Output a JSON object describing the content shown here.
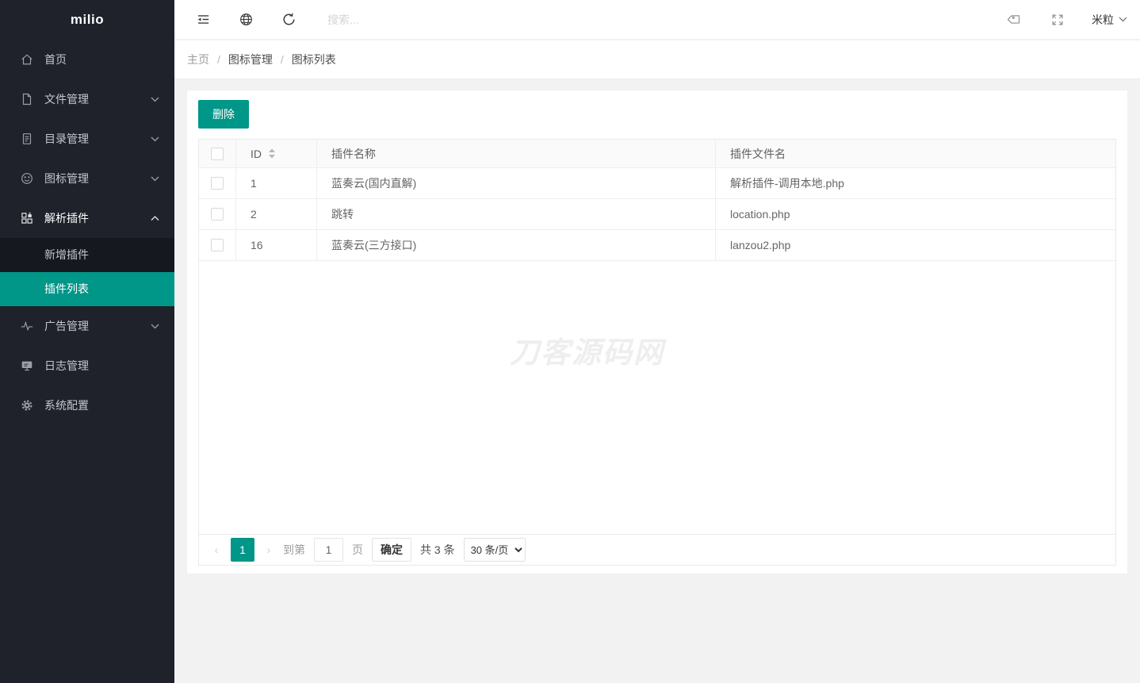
{
  "app": {
    "logo": "milio"
  },
  "sidebar": {
    "items": [
      {
        "label": "首页",
        "icon": "home-icon"
      },
      {
        "label": "文件管理",
        "icon": "file-icon",
        "chevron": "down"
      },
      {
        "label": "目录管理",
        "icon": "document-icon",
        "chevron": "down"
      },
      {
        "label": "图标管理",
        "icon": "smiley-icon",
        "chevron": "down"
      },
      {
        "label": "解析插件",
        "icon": "components-icon",
        "chevron": "up",
        "expanded": true,
        "children": [
          {
            "label": "新增插件",
            "active": false
          },
          {
            "label": "插件列表",
            "active": true
          }
        ]
      },
      {
        "label": "广告管理",
        "icon": "pulse-icon",
        "chevron": "down"
      },
      {
        "label": "日志管理",
        "icon": "monitor-icon"
      },
      {
        "label": "系统配置",
        "icon": "gear-icon"
      }
    ]
  },
  "topbar": {
    "search_placeholder": "搜索...",
    "user": "米粒"
  },
  "breadcrumb": {
    "items": [
      "主页",
      "图标管理",
      "图标列表"
    ],
    "separator": "/"
  },
  "toolbar": {
    "delete_label": "删除"
  },
  "table": {
    "columns": {
      "id": "ID",
      "name": "插件名称",
      "file": "插件文件名"
    },
    "rows": [
      {
        "id": "1",
        "name": "蓝奏云(国内直解)",
        "file": "解析插件-调用本地.php"
      },
      {
        "id": "2",
        "name": "跳转",
        "file": "location.php"
      },
      {
        "id": "16",
        "name": "蓝奏云(三方接口)",
        "file": "lanzou2.php"
      }
    ]
  },
  "watermark": "刀客源码网",
  "pagination": {
    "current_page": "1",
    "goto_label": "到第",
    "goto_value": "1",
    "page_label": "页",
    "confirm_label": "确定",
    "total_label": "共 3 条",
    "page_size": "30 条/页"
  },
  "colors": {
    "accent": "#009688",
    "sidebar_bg": "#1f222b"
  }
}
